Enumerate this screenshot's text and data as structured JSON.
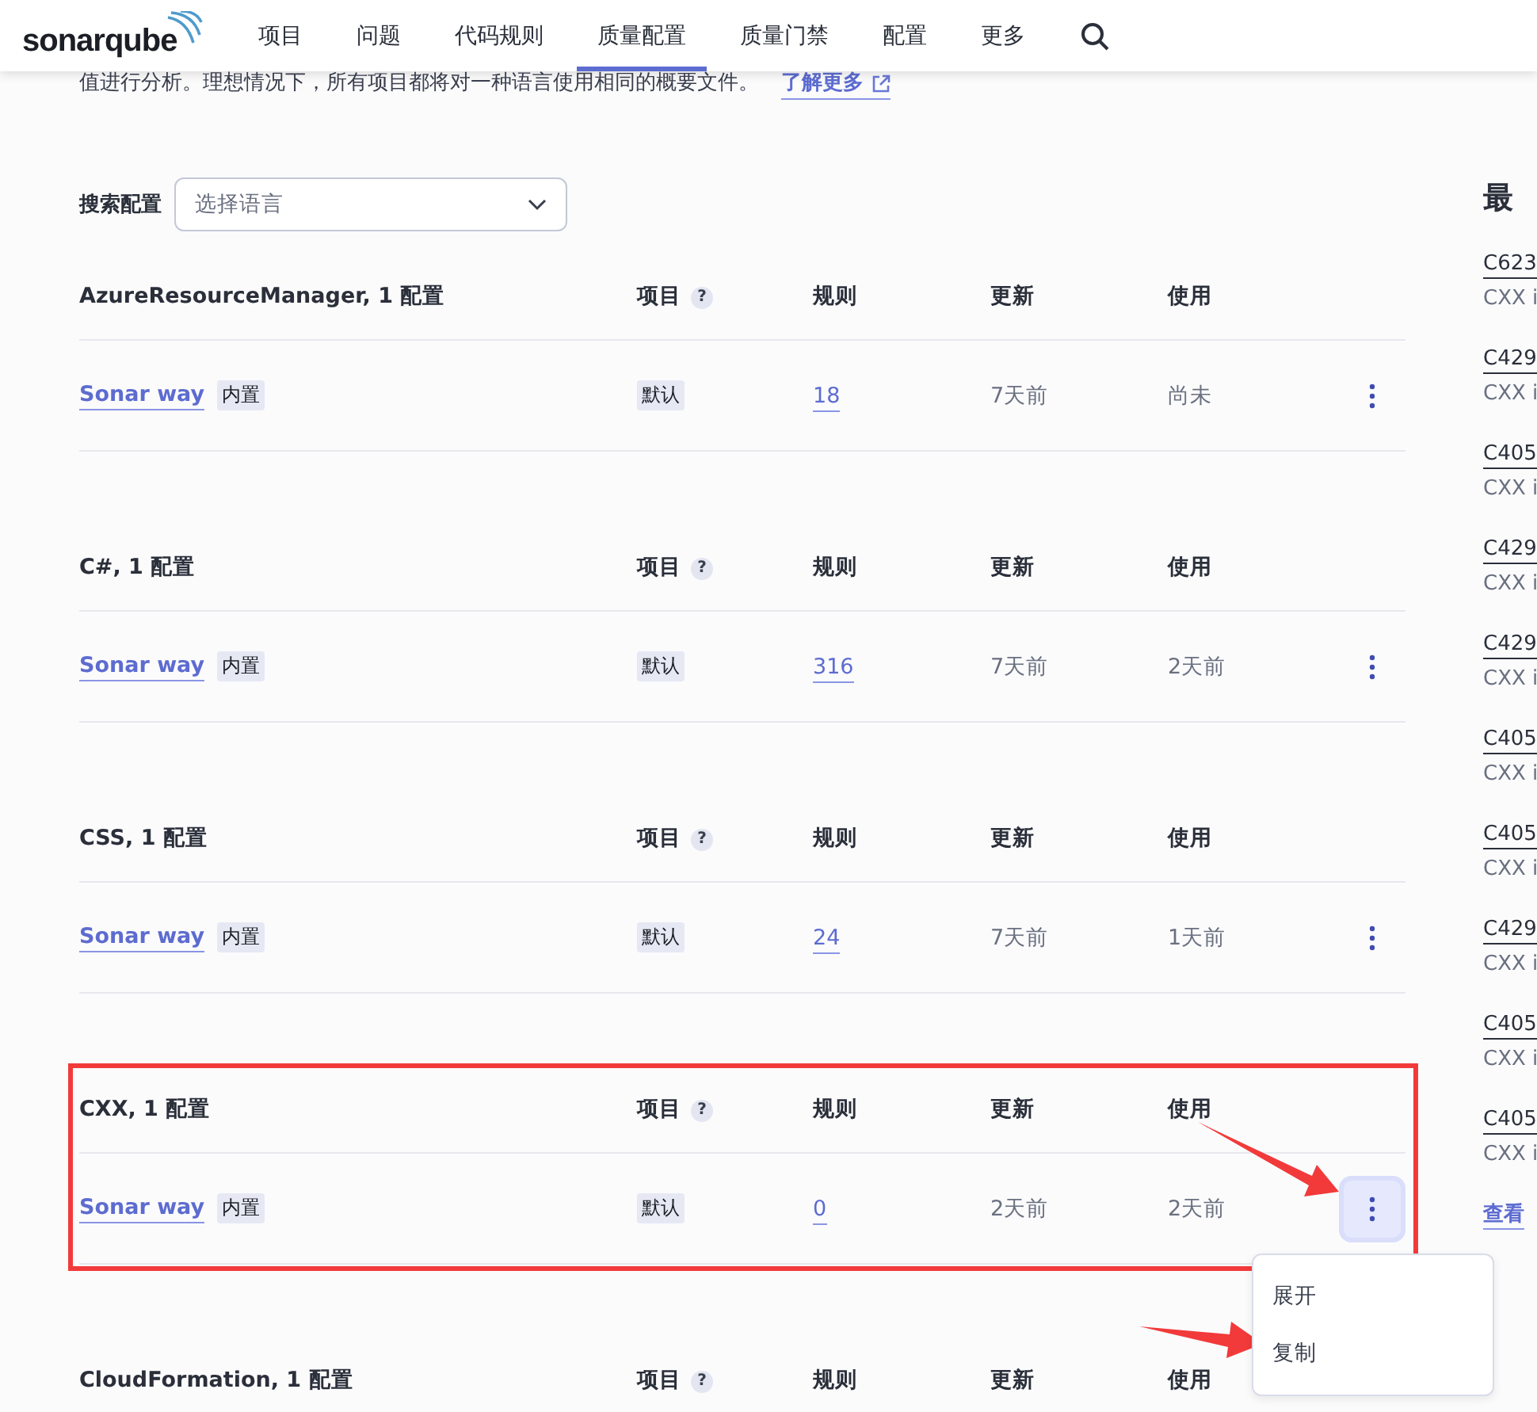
{
  "header": {
    "logo": "sonarqube",
    "nav": [
      {
        "label": "项目",
        "selected": false
      },
      {
        "label": "问题",
        "selected": false
      },
      {
        "label": "代码规则",
        "selected": false
      },
      {
        "label": "质量配置",
        "selected": true
      },
      {
        "label": "质量门禁",
        "selected": false
      },
      {
        "label": "配置",
        "selected": false
      },
      {
        "label": "更多",
        "selected": false
      }
    ]
  },
  "intro": {
    "text": "值进行分析。理想情况下，所有项目都将对一种语言使用相同的概要文件。",
    "link": "了解更多"
  },
  "search": {
    "label": "搜索配置",
    "placeholder": "选择语言"
  },
  "languages": [
    {
      "title": "AzureResourceManager, 1 配置",
      "highlighted": false,
      "columns": [
        "项目",
        "规则",
        "更新",
        "使用"
      ],
      "help": "?",
      "profiles": [
        {
          "name": "Sonar way",
          "badge": "内置",
          "projects": "默认",
          "rules": "18",
          "updated": "7天前",
          "used": "尚未",
          "menu_open": false
        }
      ]
    },
    {
      "title": "C#, 1 配置",
      "highlighted": false,
      "columns": [
        "项目",
        "规则",
        "更新",
        "使用"
      ],
      "help": "?",
      "profiles": [
        {
          "name": "Sonar way",
          "badge": "内置",
          "projects": "默认",
          "rules": "316",
          "updated": "7天前",
          "used": "2天前",
          "menu_open": false
        }
      ]
    },
    {
      "title": "CSS, 1 配置",
      "highlighted": false,
      "columns": [
        "项目",
        "规则",
        "更新",
        "使用"
      ],
      "help": "?",
      "profiles": [
        {
          "name": "Sonar way",
          "badge": "内置",
          "projects": "默认",
          "rules": "24",
          "updated": "7天前",
          "used": "1天前",
          "menu_open": false
        }
      ]
    },
    {
      "title": "CXX, 1 配置",
      "highlighted": true,
      "columns": [
        "项目",
        "规则",
        "更新",
        "使用"
      ],
      "help": "?",
      "profiles": [
        {
          "name": "Sonar way",
          "badge": "内置",
          "projects": "默认",
          "rules": "0",
          "updated": "2天前",
          "used": "2天前",
          "menu_open": true,
          "menu_items": [
            "展开",
            "复制"
          ]
        }
      ]
    },
    {
      "title": "CloudFormation, 1 配置",
      "highlighted": false,
      "columns": [
        "项目",
        "规则",
        "更新",
        "使用"
      ],
      "help": "?"
    }
  ],
  "recent": {
    "title": "最",
    "items": [
      {
        "name": "C623",
        "language": "CXX i"
      },
      {
        "name": "C429",
        "language": "CXX i"
      },
      {
        "name": "C405",
        "language": "CXX i"
      },
      {
        "name": "C429",
        "language": "CXX i"
      },
      {
        "name": "C429",
        "language": "CXX i"
      },
      {
        "name": "C405",
        "language": "CXX i"
      },
      {
        "name": "C405",
        "language": "CXX i"
      },
      {
        "name": "C429",
        "language": "CXX i"
      },
      {
        "name": "C405",
        "language": "CXX i"
      },
      {
        "name": "C405",
        "language": "CXX i"
      }
    ],
    "more": "查看"
  }
}
